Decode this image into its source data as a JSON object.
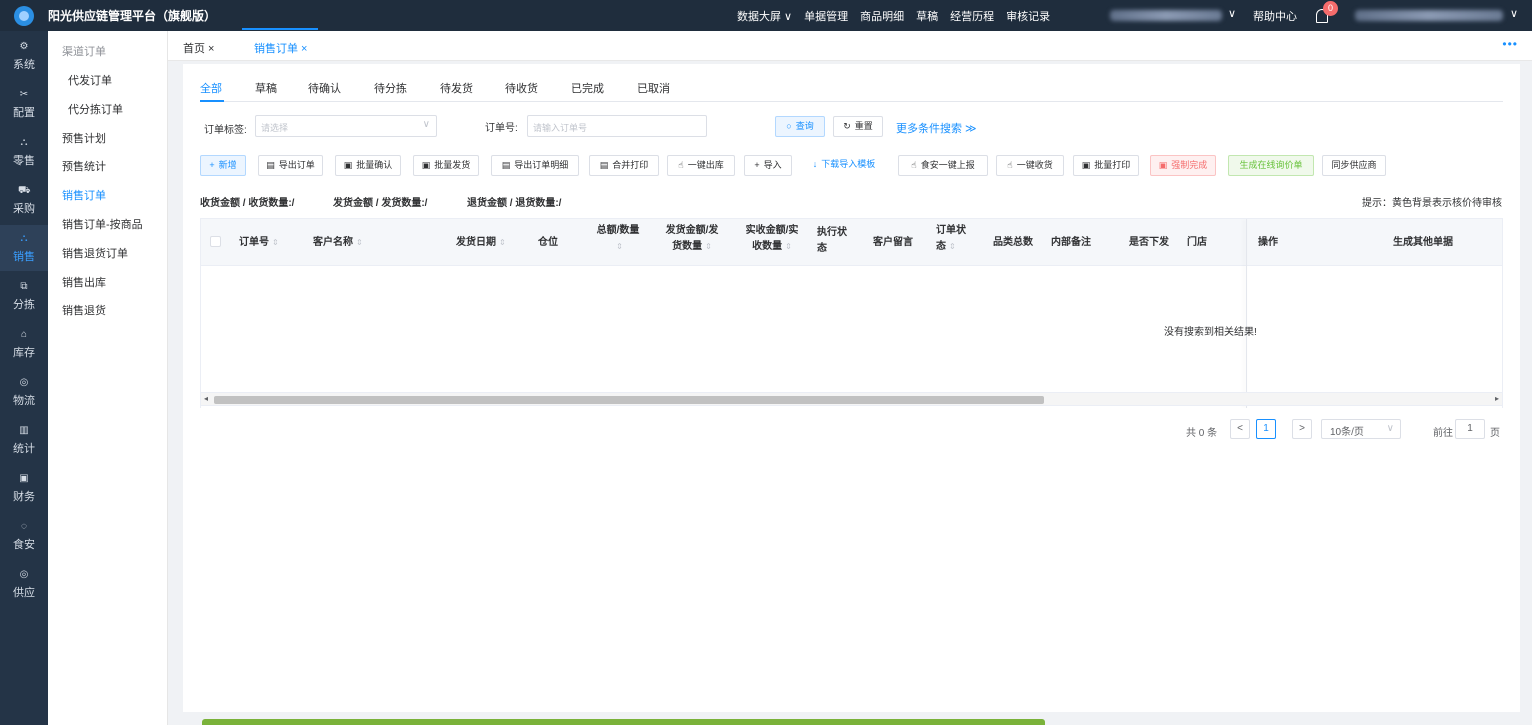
{
  "header": {
    "app_title": "阳光供应链管理平台（旗舰版）",
    "nav": [
      "数据大屏 ∨",
      "单据管理",
      "商品明细",
      "草稿",
      "经营历程",
      "审核记录"
    ],
    "help": "帮助中心",
    "notification_count": "0",
    "dropdown_arrow": "∨"
  },
  "rail": [
    {
      "label": "系统",
      "icon": "⚙"
    },
    {
      "label": "配置",
      "icon": "✂"
    },
    {
      "label": "零售",
      "icon": "⛬"
    },
    {
      "label": "采购",
      "icon": "⛟"
    },
    {
      "label": "销售",
      "icon": "⛬"
    },
    {
      "label": "分拣",
      "icon": "⧉"
    },
    {
      "label": "库存",
      "icon": "⌂"
    },
    {
      "label": "物流",
      "icon": "◎"
    },
    {
      "label": "统计",
      "icon": "▥"
    },
    {
      "label": "财务",
      "icon": "▣"
    },
    {
      "label": "食安",
      "icon": "◌"
    },
    {
      "label": "供应",
      "icon": "◎"
    }
  ],
  "submenu": [
    {
      "label": "渠道订单"
    },
    {
      "label": "代发订单"
    },
    {
      "label": "代分拣订单"
    },
    {
      "label": "预售计划"
    },
    {
      "label": "预售统计"
    },
    {
      "label": "销售订单"
    },
    {
      "label": "销售订单-按商品"
    },
    {
      "label": "销售退货订单"
    },
    {
      "label": "销售出库"
    },
    {
      "label": "销售退货"
    }
  ],
  "page_tabs": [
    {
      "label": "首页 ×"
    },
    {
      "label": "销售订单 ×"
    }
  ],
  "more_icon": "•••",
  "status_tabs": [
    "全部",
    "草稿",
    "待确认",
    "待分拣",
    "待发货",
    "待收货",
    "已完成",
    "已取消"
  ],
  "filters": {
    "tag_label": "订单标签:",
    "tag_placeholder": "请选择",
    "order_label": "订单号:",
    "order_placeholder": "请输入订单号",
    "query": "查询",
    "reset": "重置",
    "more": "更多条件搜索 ≫"
  },
  "toolbar": [
    "新增",
    "导出订单",
    "批量确认",
    "批量发货",
    "导出订单明细",
    "合并打印",
    "一键出库",
    "导入",
    "下载导入模板",
    "食安一键上报",
    "一键收货",
    "批量打印",
    "强制完成",
    "生成在线询价单",
    "同步供应商"
  ],
  "summary": {
    "receive": "收货金额 / 收货数量:/",
    "ship": "发货金额 / 发货数量:/",
    "return": "退货金额 / 退货数量:/",
    "hint": "提示：黄色背景表示核价待审核"
  },
  "table": {
    "columns": [
      {
        "label": "订单号",
        "sort": true
      },
      {
        "label": "客户名称",
        "sort": true
      },
      {
        "label": "发货日期",
        "sort": true
      },
      {
        "label": "仓位",
        "sort": false
      },
      {
        "label": "总额/数量",
        "sort": true
      },
      {
        "label": "发货金额/发货数量",
        "sort": true
      },
      {
        "label": "实收金额/实收数量",
        "sort": true
      },
      {
        "label": "执行状态",
        "sort": false
      },
      {
        "label": "客户留言",
        "sort": false
      },
      {
        "label": "订单状态",
        "sort": true
      },
      {
        "label": "品类总数",
        "sort": false
      },
      {
        "label": "内部备注",
        "sort": false
      },
      {
        "label": "是否下发",
        "sort": false
      },
      {
        "label": "门店",
        "sort": false
      },
      {
        "label": "操作",
        "sort": false
      },
      {
        "label": "生成其他单据",
        "sort": false
      }
    ],
    "empty_text": "没有搜索到相关结果!",
    "sort_icon": "⇕",
    "scroll_left": "◂",
    "scroll_right": "▸"
  },
  "pagination": {
    "total": "共 0 条",
    "prev": "<",
    "current": "1",
    "next": ">",
    "page_size": "10条/页",
    "goto_label": "前往",
    "goto_value": "1",
    "page_suffix": "页"
  },
  "progress_fraction": 0.55
}
